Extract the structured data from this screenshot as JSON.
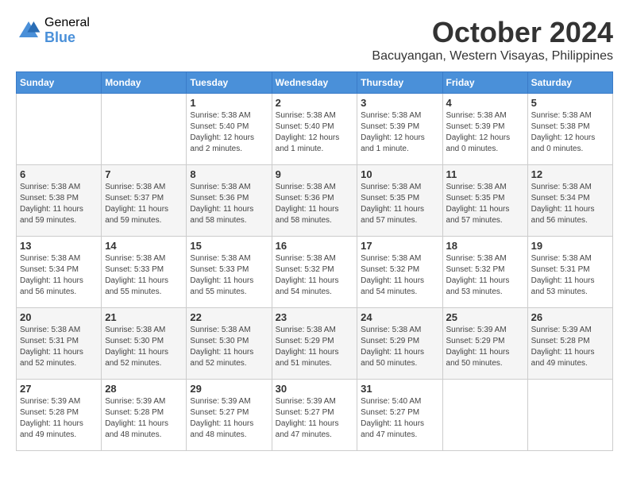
{
  "header": {
    "logo_general": "General",
    "logo_blue": "Blue",
    "month_title": "October 2024",
    "location": "Bacuyangan, Western Visayas, Philippines"
  },
  "calendar": {
    "days_of_week": [
      "Sunday",
      "Monday",
      "Tuesday",
      "Wednesday",
      "Thursday",
      "Friday",
      "Saturday"
    ],
    "weeks": [
      [
        {
          "day": "",
          "info": ""
        },
        {
          "day": "",
          "info": ""
        },
        {
          "day": "1",
          "info": "Sunrise: 5:38 AM\nSunset: 5:40 PM\nDaylight: 12 hours\nand 2 minutes."
        },
        {
          "day": "2",
          "info": "Sunrise: 5:38 AM\nSunset: 5:40 PM\nDaylight: 12 hours\nand 1 minute."
        },
        {
          "day": "3",
          "info": "Sunrise: 5:38 AM\nSunset: 5:39 PM\nDaylight: 12 hours\nand 1 minute."
        },
        {
          "day": "4",
          "info": "Sunrise: 5:38 AM\nSunset: 5:39 PM\nDaylight: 12 hours\nand 0 minutes."
        },
        {
          "day": "5",
          "info": "Sunrise: 5:38 AM\nSunset: 5:38 PM\nDaylight: 12 hours\nand 0 minutes."
        }
      ],
      [
        {
          "day": "6",
          "info": "Sunrise: 5:38 AM\nSunset: 5:38 PM\nDaylight: 11 hours\nand 59 minutes."
        },
        {
          "day": "7",
          "info": "Sunrise: 5:38 AM\nSunset: 5:37 PM\nDaylight: 11 hours\nand 59 minutes."
        },
        {
          "day": "8",
          "info": "Sunrise: 5:38 AM\nSunset: 5:36 PM\nDaylight: 11 hours\nand 58 minutes."
        },
        {
          "day": "9",
          "info": "Sunrise: 5:38 AM\nSunset: 5:36 PM\nDaylight: 11 hours\nand 58 minutes."
        },
        {
          "day": "10",
          "info": "Sunrise: 5:38 AM\nSunset: 5:35 PM\nDaylight: 11 hours\nand 57 minutes."
        },
        {
          "day": "11",
          "info": "Sunrise: 5:38 AM\nSunset: 5:35 PM\nDaylight: 11 hours\nand 57 minutes."
        },
        {
          "day": "12",
          "info": "Sunrise: 5:38 AM\nSunset: 5:34 PM\nDaylight: 11 hours\nand 56 minutes."
        }
      ],
      [
        {
          "day": "13",
          "info": "Sunrise: 5:38 AM\nSunset: 5:34 PM\nDaylight: 11 hours\nand 56 minutes."
        },
        {
          "day": "14",
          "info": "Sunrise: 5:38 AM\nSunset: 5:33 PM\nDaylight: 11 hours\nand 55 minutes."
        },
        {
          "day": "15",
          "info": "Sunrise: 5:38 AM\nSunset: 5:33 PM\nDaylight: 11 hours\nand 55 minutes."
        },
        {
          "day": "16",
          "info": "Sunrise: 5:38 AM\nSunset: 5:32 PM\nDaylight: 11 hours\nand 54 minutes."
        },
        {
          "day": "17",
          "info": "Sunrise: 5:38 AM\nSunset: 5:32 PM\nDaylight: 11 hours\nand 54 minutes."
        },
        {
          "day": "18",
          "info": "Sunrise: 5:38 AM\nSunset: 5:32 PM\nDaylight: 11 hours\nand 53 minutes."
        },
        {
          "day": "19",
          "info": "Sunrise: 5:38 AM\nSunset: 5:31 PM\nDaylight: 11 hours\nand 53 minutes."
        }
      ],
      [
        {
          "day": "20",
          "info": "Sunrise: 5:38 AM\nSunset: 5:31 PM\nDaylight: 11 hours\nand 52 minutes."
        },
        {
          "day": "21",
          "info": "Sunrise: 5:38 AM\nSunset: 5:30 PM\nDaylight: 11 hours\nand 52 minutes."
        },
        {
          "day": "22",
          "info": "Sunrise: 5:38 AM\nSunset: 5:30 PM\nDaylight: 11 hours\nand 52 minutes."
        },
        {
          "day": "23",
          "info": "Sunrise: 5:38 AM\nSunset: 5:29 PM\nDaylight: 11 hours\nand 51 minutes."
        },
        {
          "day": "24",
          "info": "Sunrise: 5:38 AM\nSunset: 5:29 PM\nDaylight: 11 hours\nand 50 minutes."
        },
        {
          "day": "25",
          "info": "Sunrise: 5:39 AM\nSunset: 5:29 PM\nDaylight: 11 hours\nand 50 minutes."
        },
        {
          "day": "26",
          "info": "Sunrise: 5:39 AM\nSunset: 5:28 PM\nDaylight: 11 hours\nand 49 minutes."
        }
      ],
      [
        {
          "day": "27",
          "info": "Sunrise: 5:39 AM\nSunset: 5:28 PM\nDaylight: 11 hours\nand 49 minutes."
        },
        {
          "day": "28",
          "info": "Sunrise: 5:39 AM\nSunset: 5:28 PM\nDaylight: 11 hours\nand 48 minutes."
        },
        {
          "day": "29",
          "info": "Sunrise: 5:39 AM\nSunset: 5:27 PM\nDaylight: 11 hours\nand 48 minutes."
        },
        {
          "day": "30",
          "info": "Sunrise: 5:39 AM\nSunset: 5:27 PM\nDaylight: 11 hours\nand 47 minutes."
        },
        {
          "day": "31",
          "info": "Sunrise: 5:40 AM\nSunset: 5:27 PM\nDaylight: 11 hours\nand 47 minutes."
        },
        {
          "day": "",
          "info": ""
        },
        {
          "day": "",
          "info": ""
        }
      ]
    ]
  }
}
